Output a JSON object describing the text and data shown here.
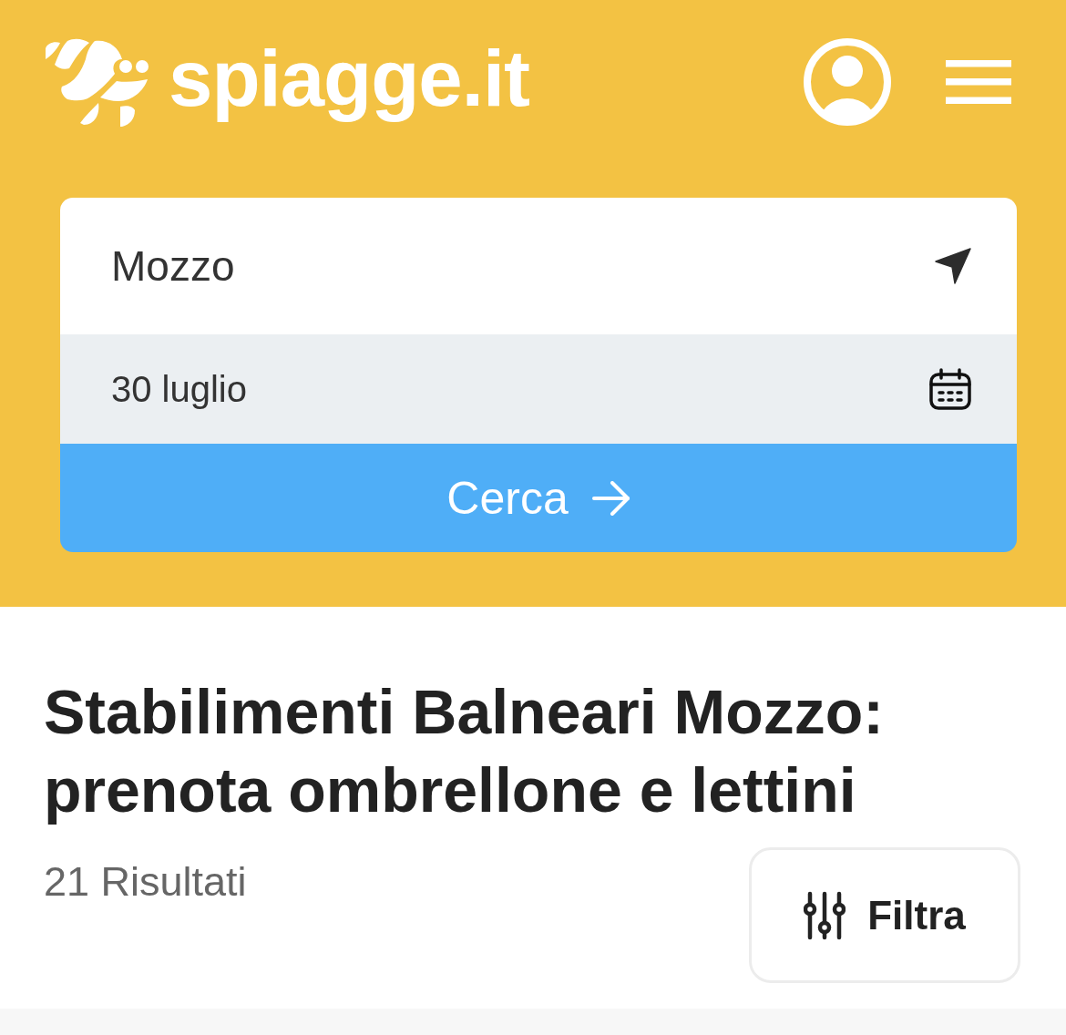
{
  "header": {
    "logo": {
      "text": "spiagge.it"
    }
  },
  "search": {
    "location": {
      "value": "Mozzo"
    },
    "date": {
      "value": "30 luglio"
    },
    "submit": {
      "label": "Cerca"
    }
  },
  "results": {
    "title": "Stabilimenti Balneari Mozzo: prenota ombrellone e lettini",
    "count": "21 Risultati",
    "filter_button": {
      "label": "Filtra"
    }
  }
}
